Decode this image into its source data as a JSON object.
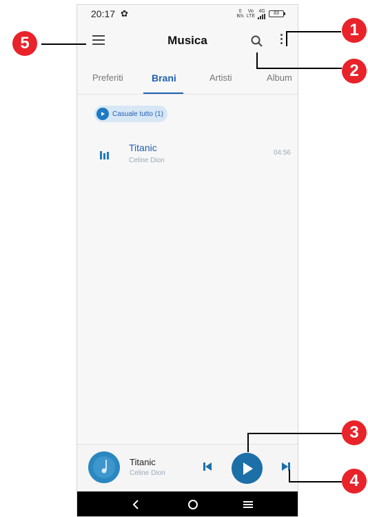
{
  "statusbar": {
    "time": "20:17",
    "battery": "83",
    "net_top": "0",
    "net_bottom": "B/s",
    "lte_top": "Vo",
    "lte_bottom": "LTE",
    "signal_label": "4G"
  },
  "appbar": {
    "title": "Musica"
  },
  "tabs": [
    {
      "label": "Preferiti",
      "active": false
    },
    {
      "label": "Brani",
      "active": true
    },
    {
      "label": "Artisti",
      "active": false
    },
    {
      "label": "Album",
      "active": false
    }
  ],
  "shuffle": {
    "label": "Casuale tutto (1)"
  },
  "songs": [
    {
      "title": "Titanic",
      "artist": "Celine Dion",
      "duration": "04:56"
    }
  ],
  "player": {
    "title": "Titanic",
    "artist": "Celine Dion"
  },
  "callouts": [
    "1",
    "2",
    "3",
    "4",
    "5"
  ],
  "colors": {
    "accent": "#1f5fb5",
    "play_button": "#1d6fa8",
    "callout": "#e8232a"
  },
  "icons": [
    "menu-icon",
    "search-icon",
    "more-vert-icon",
    "shuffle-play-icon",
    "equalizer-icon",
    "album-cover-icon",
    "skip-previous-icon",
    "play-icon",
    "skip-next-icon",
    "nav-back-icon",
    "nav-home-icon",
    "nav-recents-icon",
    "settings-gear-icon"
  ]
}
